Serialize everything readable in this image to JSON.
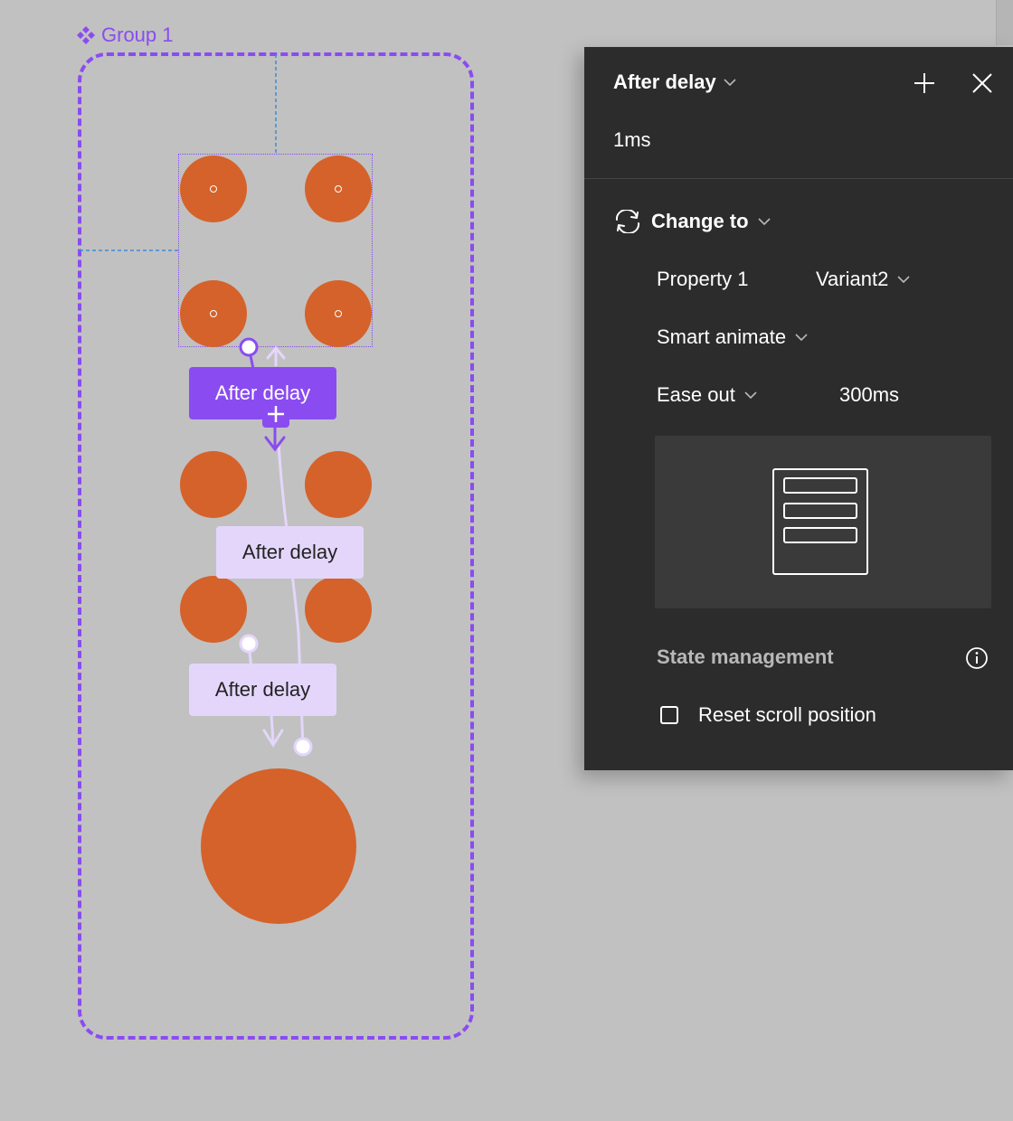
{
  "canvas": {
    "group_label": "Group 1",
    "interactions": [
      {
        "label": "After delay",
        "state": "selected"
      },
      {
        "label": "After delay",
        "state": "default"
      },
      {
        "label": "After delay",
        "state": "default"
      }
    ]
  },
  "panel": {
    "trigger": "After delay",
    "delay": "1ms",
    "action": "Change to",
    "property_name": "Property 1",
    "property_value": "Variant2",
    "animation": "Smart animate",
    "easing": "Ease out",
    "duration": "300ms",
    "state_management_label": "State management",
    "reset_scroll_label": "Reset scroll position",
    "reset_scroll_checked": false
  },
  "colors": {
    "accent": "#8a4cf0",
    "accent_light": "#e4d6fb",
    "shape": "#d5622a",
    "canvas_bg": "#c1c1c1",
    "panel_bg": "#2c2c2c"
  },
  "icons": [
    "component-icon",
    "plus-icon",
    "close-icon",
    "chevron-down-icon",
    "swap-icon",
    "info-icon",
    "device-preview-icon"
  ]
}
